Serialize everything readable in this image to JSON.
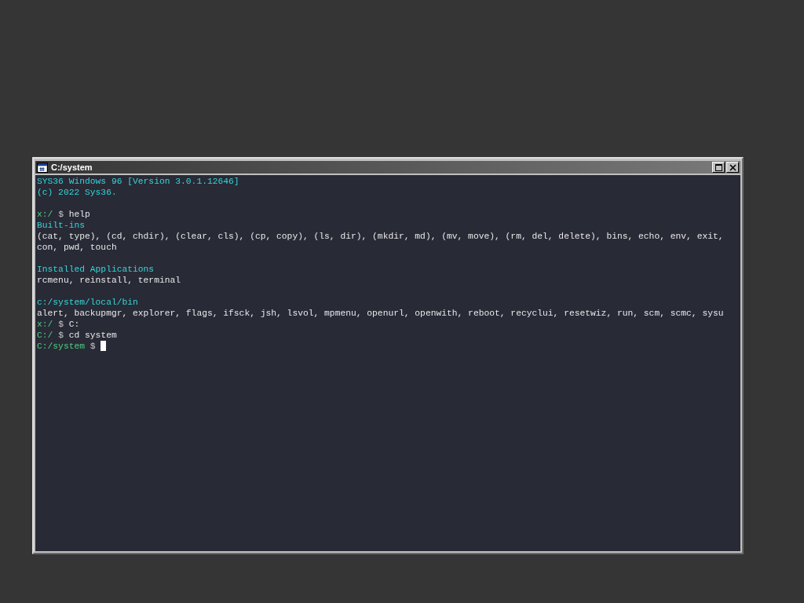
{
  "window": {
    "title": "C:/system"
  },
  "terminal": {
    "lines": [
      {
        "kind": "info",
        "text": "SYS36 Windows 96 [Version 3.0.1.12646]"
      },
      {
        "kind": "info",
        "text": "(c) 2022 Sys36."
      },
      {
        "kind": "blank"
      },
      {
        "kind": "prompt",
        "path": "x:/",
        "symbol": "$",
        "command": "help",
        "cursor": false
      },
      {
        "kind": "heading",
        "text": "Built-ins"
      },
      {
        "kind": "text",
        "text": "(cat, type), (cd, chdir), (clear, cls), (cp, copy), (ls, dir), (mkdir, md), (mv, move), (rm, del, delete), bins, echo, env, exit,"
      },
      {
        "kind": "text",
        "text": "con, pwd, touch"
      },
      {
        "kind": "blank"
      },
      {
        "kind": "heading",
        "text": "Installed Applications"
      },
      {
        "kind": "text",
        "text": "rcmenu, reinstall, terminal"
      },
      {
        "kind": "blank"
      },
      {
        "kind": "heading",
        "text": "c:/system/local/bin"
      },
      {
        "kind": "text",
        "text": "alert, backupmgr, explorer, flags, ifsck, jsh, lsvol, mpmenu, openurl, openwith, reboot, recyclui, resetwiz, run, scm, scmc, sysu"
      },
      {
        "kind": "prompt",
        "path": "x:/",
        "symbol": "$",
        "command": "C:",
        "cursor": false
      },
      {
        "kind": "prompt",
        "path": "C:/",
        "symbol": "$",
        "command": "cd system",
        "cursor": false
      },
      {
        "kind": "prompt",
        "path": "C:/system",
        "symbol": "$",
        "cursor": true
      }
    ]
  }
}
